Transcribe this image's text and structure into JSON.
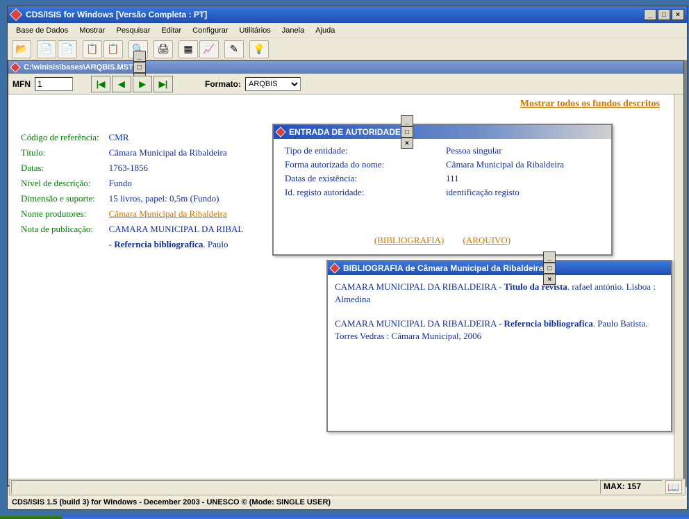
{
  "main_window": {
    "title": "CDS/ISIS for Windows [Versão Completa : PT]"
  },
  "menu": {
    "items": [
      "Base de Dados",
      "Mostrar",
      "Pesquisar",
      "Editar",
      "Configurar",
      "Utilitários",
      "Janela",
      "Ajuda"
    ]
  },
  "toolbar_icons": [
    "open",
    "txt",
    "rtf",
    "copy",
    "paste",
    "find",
    "print",
    "form",
    "chart",
    "edit",
    "bulb"
  ],
  "doc_window": {
    "title": "C:\\winisis\\bases\\ARQBIS.MST",
    "mfn_label": "MFN",
    "mfn_value": "1",
    "format_label": "Formato:",
    "format_value": "ARQBIS",
    "show_all_link": "Mostrar todos os fundos descritos"
  },
  "record": {
    "fields": [
      {
        "label": "Código de referência:",
        "value": "CMR"
      },
      {
        "label": "Título:",
        "value": "Câmara Municipal da Ribaldeira"
      },
      {
        "label": "Datas:",
        "value": "1763-1856"
      },
      {
        "label": "Nível de descrição:",
        "value": "Fundo"
      },
      {
        "label": "Dimensão e suporte:",
        "value": "15 livros, papel: 0,5m (Fundo)"
      },
      {
        "label": "Nome produtores:",
        "value_link": "Câmara Municipal da Ribaldeira"
      },
      {
        "label": "Nota de publicação:",
        "value_prefix": "CAMARA MUNICIPAL DA RIBAL",
        "value_line2_prefix": " - ",
        "value_line2_bold": "Referncia bibliografica",
        "value_line2_suffix": ". Paulo"
      }
    ]
  },
  "authority": {
    "title": "ENTRADA DE AUTORIDADE",
    "rows": [
      {
        "label": "Tipo de entidade:",
        "value": "Pessoa singular"
      },
      {
        "label": "Forma autorizada do nome:",
        "value": "Câmara Municipal da Ribaldeira"
      },
      {
        "label": "Datas de existência:",
        "value": "111"
      },
      {
        "label": "Id. registo autoridade:",
        "value": "identificação registo"
      }
    ],
    "link_biblio": "(BIBLIOGRAFIA)",
    "link_arquivo": "(ARQUIVO)"
  },
  "biblio": {
    "title": "BIBLIOGRAFIA de Câmara Municipal da Ribaldeira",
    "entries": [
      {
        "prefix": "CAMARA MUNICIPAL DA RIBALDEIRA - ",
        "bold": "Titulo da revista",
        "suffix": ".  rafael antónio. Lisboa : Almedina"
      },
      {
        "prefix": "CAMARA MUNICIPAL DA RIBALDEIRA - ",
        "bold": "Referncia bibliografica",
        "suffix": ". Paulo Batista. Torres Vedras : Câmara Municipal, 2006"
      }
    ]
  },
  "status": {
    "max": "MAX: 157",
    "line": "CDS/ISIS 1.5 (build 3) for Windows - December 2003 - UNESCO © (Mode: SINGLE USER)"
  }
}
